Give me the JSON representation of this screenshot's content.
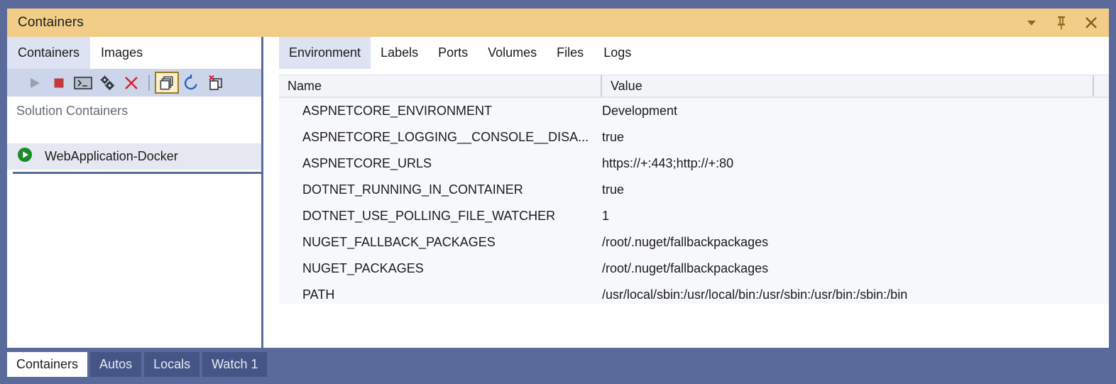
{
  "window": {
    "title": "Containers",
    "frame_color": "#5a6a9a",
    "titlebar_color": "#f2cd88",
    "controls": [
      {
        "name": "dropdown-chevron",
        "glyph": "chevron-down-icon"
      },
      {
        "name": "pin",
        "glyph": "pin-icon"
      },
      {
        "name": "close",
        "glyph": "close-icon"
      }
    ]
  },
  "left_pane": {
    "tabs": [
      {
        "label": "Containers",
        "active": true
      },
      {
        "label": "Images",
        "active": false
      }
    ],
    "toolbar": [
      {
        "name": "start-icon",
        "enabled": false
      },
      {
        "name": "stop-icon",
        "enabled": true
      },
      {
        "name": "terminal-icon",
        "enabled": true
      },
      {
        "name": "gears-icon",
        "enabled": true
      },
      {
        "name": "kill-icon",
        "enabled": true
      },
      {
        "name": "separator"
      },
      {
        "name": "show-containers-icon",
        "enabled": true,
        "pressed": true
      },
      {
        "name": "refresh-icon",
        "enabled": true
      },
      {
        "name": "remove-container-icon",
        "enabled": true
      }
    ],
    "section_title": "Solution Containers",
    "items": [
      {
        "label": "WebApplication-Docker",
        "state": "running",
        "selected": true
      }
    ]
  },
  "right_pane": {
    "tabs": [
      {
        "label": "Environment",
        "active": true
      },
      {
        "label": "Labels",
        "active": false
      },
      {
        "label": "Ports",
        "active": false
      },
      {
        "label": "Volumes",
        "active": false
      },
      {
        "label": "Files",
        "active": false
      },
      {
        "label": "Logs",
        "active": false
      }
    ],
    "grid": {
      "columns": [
        "Name",
        "Value"
      ],
      "rows": [
        {
          "name": "ASPNETCORE_ENVIRONMENT",
          "value": "Development"
        },
        {
          "name": "ASPNETCORE_LOGGING__CONSOLE__DISA...",
          "value": "true"
        },
        {
          "name": "ASPNETCORE_URLS",
          "value": "https://+:443;http://+:80"
        },
        {
          "name": "DOTNET_RUNNING_IN_CONTAINER",
          "value": "true"
        },
        {
          "name": "DOTNET_USE_POLLING_FILE_WATCHER",
          "value": "1"
        },
        {
          "name": "NUGET_FALLBACK_PACKAGES",
          "value": "/root/.nuget/fallbackpackages"
        },
        {
          "name": "NUGET_PACKAGES",
          "value": "/root/.nuget/fallbackpackages"
        },
        {
          "name": "PATH",
          "value": "/usr/local/sbin:/usr/local/bin:/usr/sbin:/usr/bin:/sbin:/bin"
        }
      ]
    }
  },
  "bottom_tabs": [
    {
      "label": "Containers",
      "active": true
    },
    {
      "label": "Autos",
      "active": false
    },
    {
      "label": "Locals",
      "active": false
    },
    {
      "label": "Watch 1",
      "active": false
    }
  ]
}
